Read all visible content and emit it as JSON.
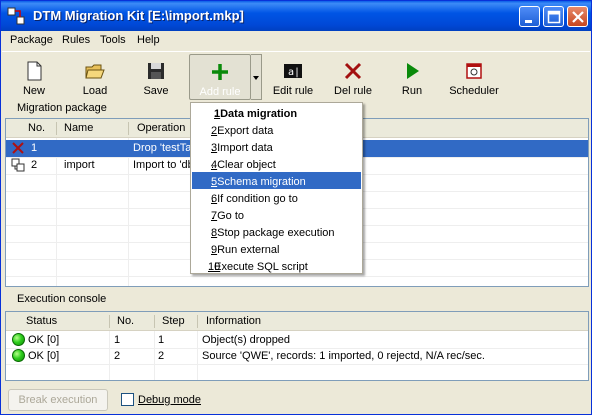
{
  "window": {
    "title": "DTM Migration Kit [E:\\import.mkp]",
    "controls": [
      "minimize",
      "maximize",
      "close"
    ]
  },
  "menubar": [
    "Package",
    "Rules",
    "Tools",
    "Help"
  ],
  "toolbar": {
    "buttons": [
      {
        "label": "New",
        "icon": "new-document-icon"
      },
      {
        "label": "Load",
        "icon": "open-folder-icon"
      },
      {
        "label": "Save",
        "icon": "save-disk-icon"
      },
      {
        "label": "Add rule",
        "icon": "plus-icon",
        "pressed": true
      },
      {
        "label": "Edit rule",
        "icon": "edit-rule-icon"
      },
      {
        "label": "Del rule",
        "icon": "delete-x-icon"
      },
      {
        "label": "Run",
        "icon": "play-icon"
      },
      {
        "label": "Scheduler",
        "icon": "scheduler-icon"
      }
    ]
  },
  "package": {
    "section_label": "Migration package",
    "columns": [
      "No.",
      "Name",
      "Operation"
    ],
    "rows": [
      {
        "no": "1",
        "name": "",
        "operation": "Drop 'testTa",
        "icon": "drop-x-icon",
        "selected": true
      },
      {
        "no": "2",
        "name": "import",
        "operation": "Import to 'db",
        "icon": "import-icon",
        "selected": false
      }
    ]
  },
  "add_rule_menu": {
    "items": [
      {
        "num": "1",
        "text": ". Data migration",
        "bold": true
      },
      {
        "num": "2",
        "text": ". Export data"
      },
      {
        "num": "3",
        "text": ". Import data"
      },
      {
        "num": "4",
        "text": ". Clear object"
      },
      {
        "num": "5",
        "text": ". Schema migration",
        "highlighted": true
      },
      {
        "num": "6",
        "text": ". If condition go to"
      },
      {
        "num": "7",
        "text": ". Go to"
      },
      {
        "num": "8",
        "text": ". Stop package execution"
      },
      {
        "num": "9",
        "text": ". Run external"
      },
      {
        "num": "10",
        "text": ". Execute SQL script"
      }
    ]
  },
  "console": {
    "section_label": "Execution console",
    "columns": [
      "Status",
      "No.",
      "Step",
      "Information"
    ],
    "rows": [
      {
        "status": "OK [0]",
        "no": "1",
        "step": "1",
        "info": "Object(s) dropped"
      },
      {
        "status": "OK [0]",
        "no": "2",
        "step": "2",
        "info": "Source 'QWE', records: 1 imported, 0 rejectd, N/A rec/sec."
      }
    ]
  },
  "bottom": {
    "break_button": "Break execution",
    "debug_label": "Debug mode",
    "debug_checked": false
  },
  "colors": {
    "title_bar": "#0055e5",
    "selection": "#316ac5",
    "status_ok": "#2fcf1e"
  }
}
